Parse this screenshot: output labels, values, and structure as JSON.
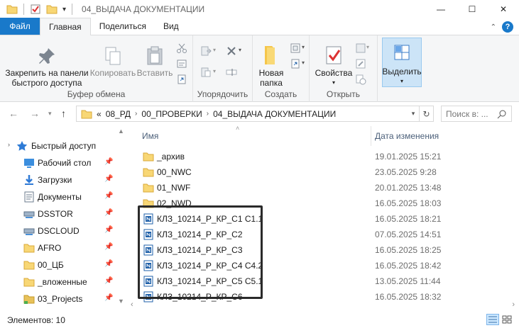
{
  "window": {
    "title": "04_ВЫДАЧА ДОКУМЕНТАЦИИ",
    "controls": {
      "minimize": "—",
      "maximize": "☐",
      "close": "✕"
    }
  },
  "ribbon_tabs": [
    {
      "label": "Файл",
      "active": false
    },
    {
      "label": "Главная",
      "active": true
    },
    {
      "label": "Поделиться",
      "active": false
    },
    {
      "label": "Вид",
      "active": false
    }
  ],
  "ribbon": {
    "clipboard": {
      "label": "Буфер обмена",
      "pin_label_1": "Закрепить на панели",
      "pin_label_2": "быстрого доступа",
      "copy_label": "Копировать",
      "paste_label": "Вставить"
    },
    "organize": {
      "label": "Упорядочить"
    },
    "create": {
      "label": "Создать",
      "new_folder_1": "Новая",
      "new_folder_2": "папка"
    },
    "open": {
      "label": "Открыть",
      "properties_label": "Свойства"
    },
    "select": {
      "label": "Выделить"
    }
  },
  "address": {
    "prefix": "«",
    "crumbs": [
      "08_РД",
      "00_ПРОВЕРКИ",
      "04_ВЫДАЧА ДОКУМЕНТАЦИИ"
    ],
    "search_placeholder": "Поиск в: ..."
  },
  "nav_pane": {
    "quick_access": "Быстрый доступ",
    "items": [
      {
        "label": "Рабочий стол",
        "icon": "desktop-icon",
        "color": "#3b8ede"
      },
      {
        "label": "Загрузки",
        "icon": "downloads-icon",
        "color": "#2f7ad6"
      },
      {
        "label": "Документы",
        "icon": "documents-icon",
        "color": "#6b7b8c"
      },
      {
        "label": "DSSTOR",
        "icon": "network-drive-icon",
        "color": "#4a90d9"
      },
      {
        "label": "DSCLOUD",
        "icon": "network-drive-icon",
        "color": "#4a90d9"
      },
      {
        "label": "AFRO",
        "icon": "folder-icon",
        "color": "#f8d775"
      },
      {
        "label": "00_ЦБ",
        "icon": "folder-icon",
        "color": "#f8d775"
      },
      {
        "label": "_вложенные",
        "icon": "folder-icon",
        "color": "#f8d775"
      },
      {
        "label": "03_Projects",
        "icon": "folder-green-icon",
        "color": "#e8c25a"
      }
    ]
  },
  "file_list": {
    "columns": {
      "name": "Имя",
      "date": "Дата изменения"
    },
    "rows": [
      {
        "name": "_архив",
        "date": "19.01.2025 15:21",
        "type": "folder"
      },
      {
        "name": "00_NWC",
        "date": "23.05.2025 9:28",
        "type": "folder"
      },
      {
        "name": "01_NWF",
        "date": "20.01.2025 13:48",
        "type": "folder"
      },
      {
        "name": "02_NWD",
        "date": "16.05.2025 18:03",
        "type": "folder"
      },
      {
        "name": "КЛЗ_10214_Р_КР_С1 С1.1",
        "date": "16.05.2025 18:21",
        "type": "nwd"
      },
      {
        "name": "КЛЗ_10214_Р_КР_С2",
        "date": "07.05.2025 14:51",
        "type": "nwd"
      },
      {
        "name": "КЛЗ_10214_Р_КР_С3",
        "date": "16.05.2025 18:25",
        "type": "nwd"
      },
      {
        "name": "КЛЗ_10214_Р_КР_С4 С4.2",
        "date": "16.05.2025 18:42",
        "type": "nwd"
      },
      {
        "name": "КЛЗ_10214_Р_КР_С5 С5.1",
        "date": "13.05.2025 11:44",
        "type": "nwd"
      },
      {
        "name": "КЛЗ_10214_Р_КР_С6",
        "date": "16.05.2025 18:32",
        "type": "nwd"
      }
    ]
  },
  "status": {
    "items_count": "Элементов: 10"
  }
}
